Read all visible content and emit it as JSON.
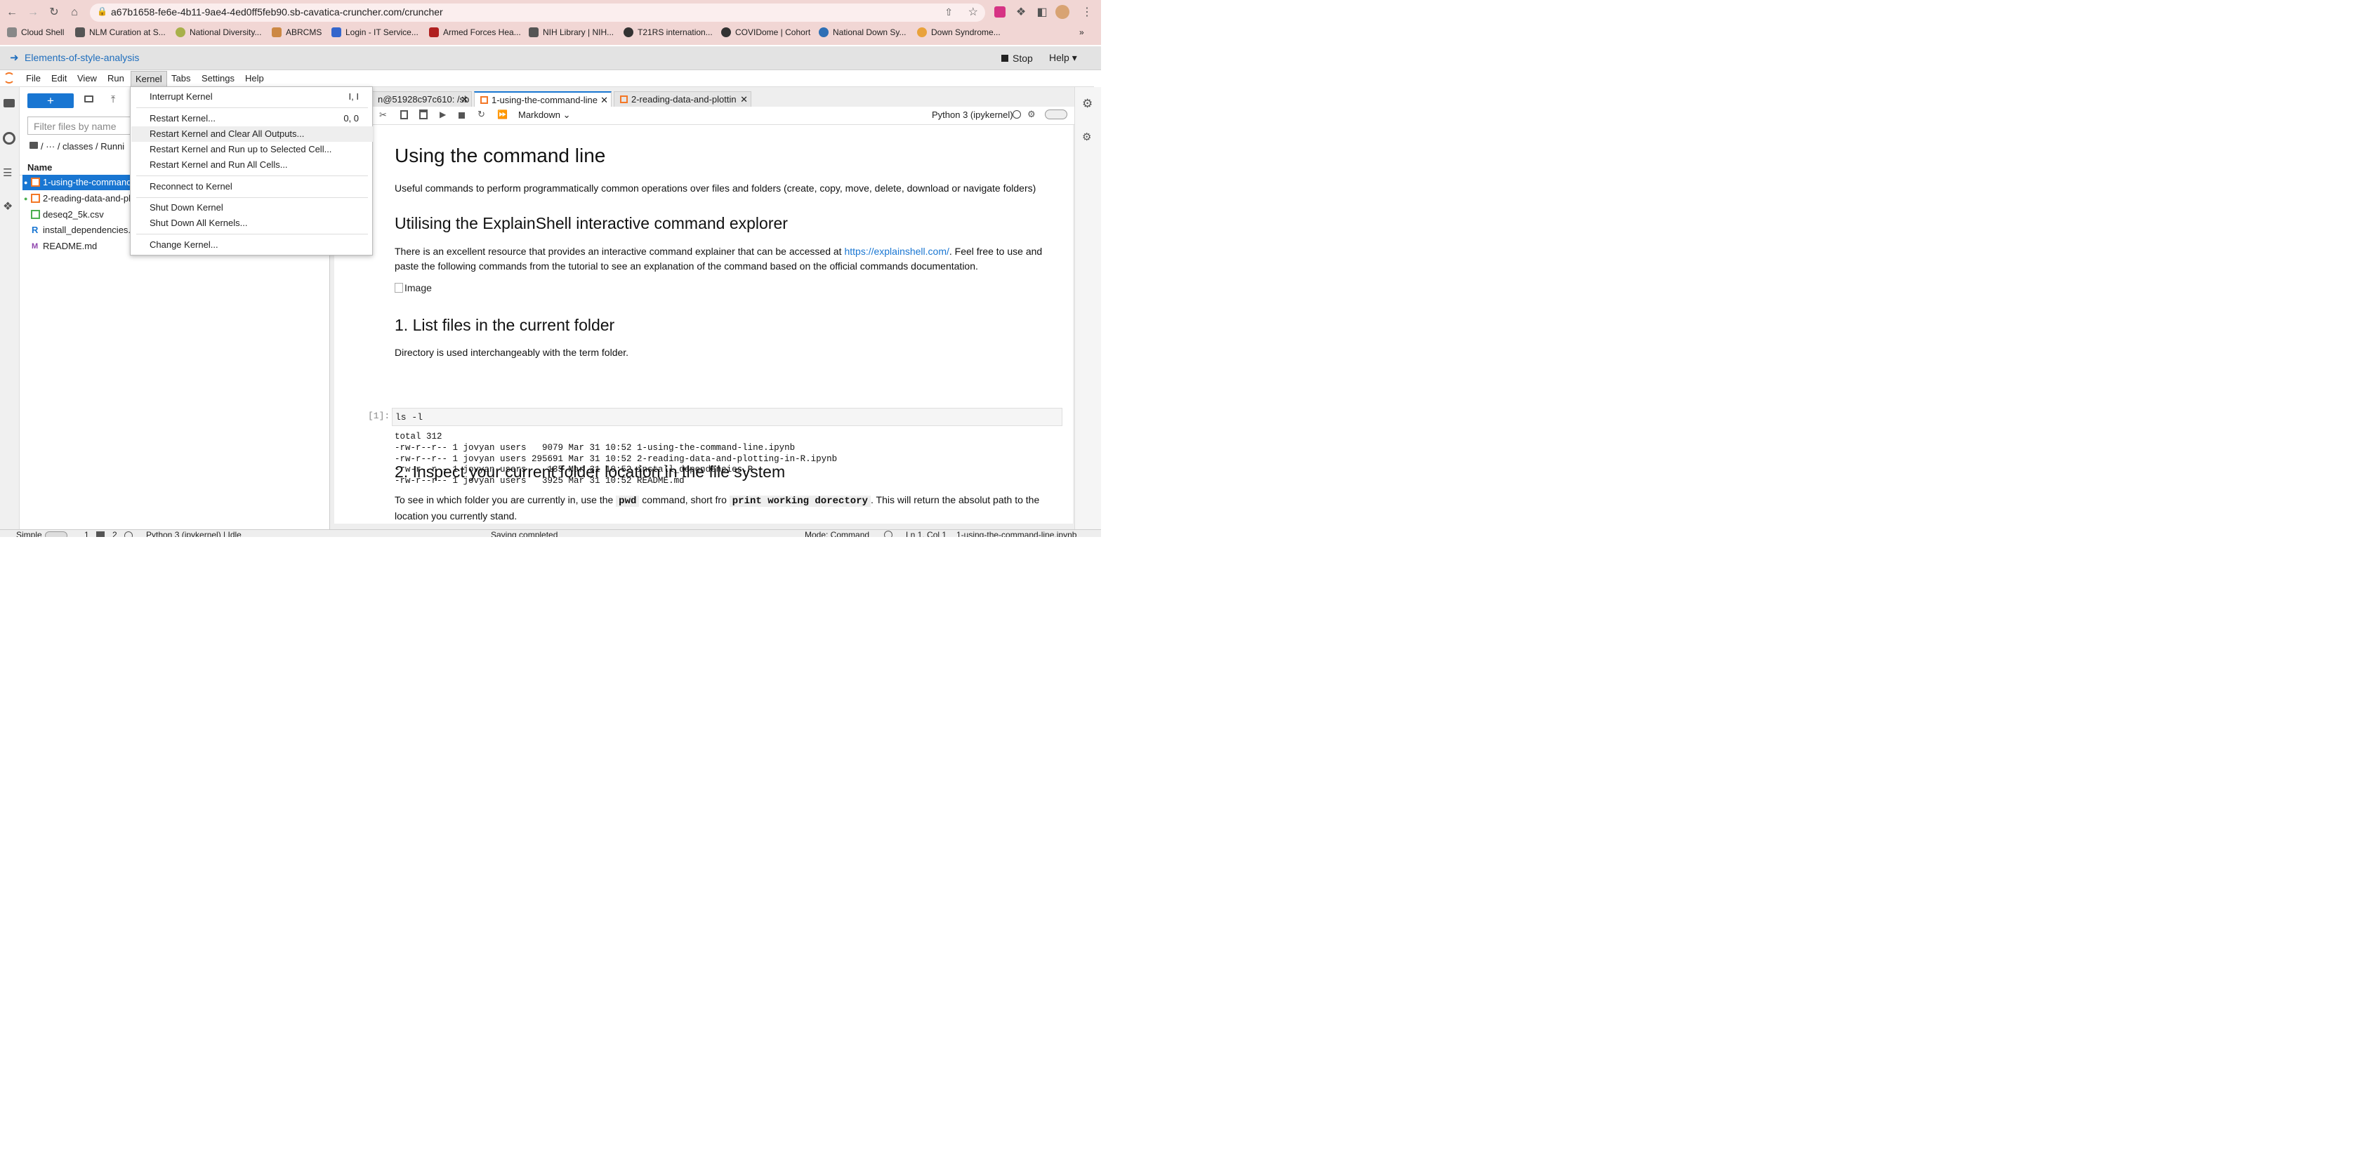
{
  "browser": {
    "url": "a67b1658-fe6e-4b11-9ae4-4ed0ff5feb90.sb-cavatica-cruncher.com/cruncher",
    "bookmarks": [
      "Cloud Shell",
      "NLM Curation at S...",
      "National Diversity...",
      "ABRCMS",
      "Login - IT Service...",
      "Armed Forces Hea...",
      "NIH Library | NIH...",
      "T21RS internation...",
      "COVIDome | Cohort",
      "National Down Sy...",
      "Down Syndrome..."
    ],
    "more": "»"
  },
  "hub": {
    "title": "Elements-of-style-analysis",
    "stop_label": "Stop",
    "help_label": "Help"
  },
  "menubar": {
    "items": [
      "File",
      "Edit",
      "View",
      "Run",
      "Kernel",
      "Tabs",
      "Settings",
      "Help"
    ]
  },
  "kernel_menu": {
    "items": [
      {
        "label": "Interrupt Kernel",
        "shortcut": "I, I"
      },
      {
        "label": "Restart Kernel...",
        "shortcut": "0, 0"
      },
      {
        "label": "Restart Kernel and Clear All Outputs...",
        "shortcut": ""
      },
      {
        "label": "Restart Kernel and Run up to Selected Cell...",
        "shortcut": ""
      },
      {
        "label": "Restart Kernel and Run All Cells...",
        "shortcut": ""
      },
      {
        "label": "Reconnect to Kernel",
        "shortcut": ""
      },
      {
        "label": "Shut Down Kernel",
        "shortcut": ""
      },
      {
        "label": "Shut Down All Kernels...",
        "shortcut": ""
      },
      {
        "label": "Change Kernel...",
        "shortcut": ""
      }
    ]
  },
  "filebrowser": {
    "new_label": "+",
    "filter_placeholder": "Filter files by name",
    "breadcrumb": "/ ··· / classes / Runni",
    "column_name": "Name",
    "files": [
      {
        "name": "1-using-the-command-line.ipynb"
      },
      {
        "name": "2-reading-data-and-plotting-in-R.ipynb"
      },
      {
        "name": "deseq2_5k.csv"
      },
      {
        "name": "install_dependencies.R"
      },
      {
        "name": "README.md"
      }
    ]
  },
  "tabs": [
    {
      "label": "n@51928c97c610: /sb"
    },
    {
      "label": "1-using-the-command-line"
    },
    {
      "label": "2-reading-data-and-plottin"
    }
  ],
  "nbtoolbar": {
    "cell_type": "Markdown",
    "kernel": "Python 3 (ipykernel)"
  },
  "notebook": {
    "h1": "Using the command line",
    "p1": "Useful commands to perform programmatically common operations over files and folders (create, copy, move, delete, download or navigate folders)",
    "h2a": "Utilising the ExplainShell interactive command explorer",
    "p2_start": "There is an excellent resource that provides an interactive command explainer that can be accessed at ",
    "p2_link": "https://explainshell.com/",
    "p2_end": ". Feel free to use and paste the following commands from the tutorial to see an explanation of the command based on the official commands documentation.",
    "image_alt": "Image",
    "h2b": "1. List files in the current folder",
    "p3": "Directory is used interchangeably with the term folder.",
    "prompt": "[1]:",
    "code": "ls -l",
    "output": "total 312\n-rw-r--r-- 1 jovyan users   9079 Mar 31 10:52 1-using-the-command-line.ipynb\n-rw-r--r-- 1 jovyan users 295691 Mar 31 10:52 2-reading-data-and-plotting-in-R.ipynb\n-rw-r--r-- 1 jovyan users    135 Mar 31 10:52 install_dependencies.R\n-rw-r--r-- 1 jovyan users   3925 Mar 31 10:52 README.md",
    "h2c": "2. Inspect your current folder location in the file system",
    "p4_a": "To see in which folder you are currently in, use the ",
    "p4_code1": "pwd",
    "p4_b": " command, short fro ",
    "p4_code2": "print working dorectory",
    "p4_c": ". This will return the absolut path to the location you currently stand."
  },
  "statusbar": {
    "simple": "Simple",
    "n1": "1",
    "n2": "2",
    "kernel_status": "Python 3 (ipykernel) | Idle",
    "saving": "Saving completed",
    "mode": "Mode: Command",
    "position": "Ln 1, Col 1",
    "filename": "1-using-the-command-line.ipynb"
  }
}
